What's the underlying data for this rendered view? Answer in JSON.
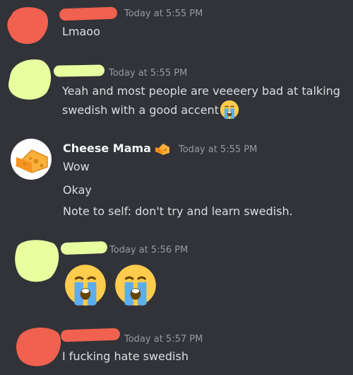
{
  "colors": {
    "background": "#313338",
    "text": "#dbdee1",
    "timestamp": "#949ba4",
    "username": "#f2f3f5",
    "scribble_red": "#f0614f",
    "scribble_green": "#e8ffa0"
  },
  "messages": [
    {
      "timestamp": "Today at 5:55 PM",
      "lines": [
        "Lmaoo"
      ]
    },
    {
      "timestamp": "Today at 5:55 PM",
      "lines": [
        "Yeah and most people are veeeery bad at talking",
        "swedish with a good accent"
      ],
      "trailing_emoji": "loudly-crying-face-icon"
    },
    {
      "username": "Cheese Mama",
      "username_emoji": "cheese-icon",
      "timestamp": "Today at 5:55 PM",
      "lines": [
        "Wow",
        "Okay",
        "Note to self: don't try and learn swedish."
      ],
      "avatar_icon": "cheese-icon"
    },
    {
      "timestamp": "Today at 5:56 PM",
      "emojis": [
        "loudly-crying-face-icon",
        "loudly-crying-face-icon"
      ]
    },
    {
      "timestamp": "Today at 5:57 PM",
      "lines": [
        "I fucking hate swedish"
      ]
    }
  ]
}
